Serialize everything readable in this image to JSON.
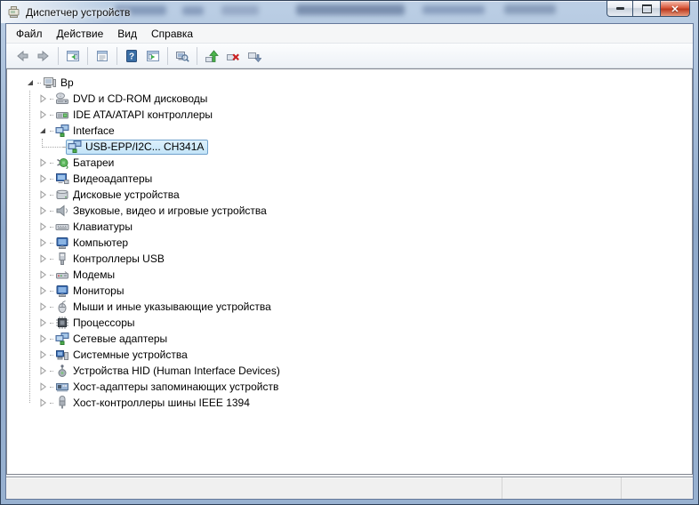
{
  "window": {
    "title": "Диспетчер устройств",
    "icon": "device-manager-icon",
    "caption_buttons": [
      {
        "name": "minimize-button",
        "icon": "minimize-icon"
      },
      {
        "name": "maximize-button",
        "icon": "maximize-icon"
      },
      {
        "name": "close-button",
        "icon": "close-icon"
      }
    ]
  },
  "menubar": {
    "items": [
      {
        "name": "file",
        "label": "Файл"
      },
      {
        "name": "action",
        "label": "Действие"
      },
      {
        "name": "view",
        "label": "Вид"
      },
      {
        "name": "help",
        "label": "Справка"
      }
    ]
  },
  "toolbar": {
    "buttons": [
      {
        "name": "back",
        "icon": "back-icon"
      },
      {
        "name": "forward",
        "icon": "forward-icon"
      },
      {
        "separator": true
      },
      {
        "name": "show-console-tree",
        "icon": "show-console-tree-icon"
      },
      {
        "separator": true
      },
      {
        "name": "properties",
        "icon": "properties-icon"
      },
      {
        "separator": true
      },
      {
        "name": "help",
        "icon": "help-icon"
      },
      {
        "name": "action-pane",
        "icon": "action-pane-icon"
      },
      {
        "separator": true
      },
      {
        "name": "scan-hardware-changes",
        "icon": "scan-hardware-icon"
      },
      {
        "separator": true
      },
      {
        "name": "update-driver",
        "icon": "update-driver-icon"
      },
      {
        "name": "uninstall-device",
        "icon": "uninstall-icon"
      },
      {
        "name": "disable-device",
        "icon": "disable-icon"
      }
    ]
  },
  "tree": {
    "items": [
      {
        "label": "Вр",
        "level": 0,
        "state": "expanded",
        "icon": "computer-icon"
      },
      {
        "label": "DVD и CD-ROM дисководы",
        "level": 1,
        "state": "collapsed",
        "icon": "dvd-icon"
      },
      {
        "label": "IDE ATA/ATAPI контроллеры",
        "level": 1,
        "state": "collapsed",
        "icon": "ide-icon"
      },
      {
        "label": "Interface",
        "level": 1,
        "state": "expanded",
        "icon": "interface-icon"
      },
      {
        "label": "USB-EPP/I2C... CH341A",
        "level": 2,
        "state": "leaf",
        "icon": "usb-epp-icon",
        "selected": true
      },
      {
        "label": "Батареи",
        "level": 1,
        "state": "collapsed",
        "icon": "battery-icon"
      },
      {
        "label": "Видеоадаптеры",
        "level": 1,
        "state": "collapsed",
        "icon": "display-adapter-icon"
      },
      {
        "label": "Дисковые устройства",
        "level": 1,
        "state": "collapsed",
        "icon": "disk-icon"
      },
      {
        "label": "Звуковые, видео и игровые устройства",
        "level": 1,
        "state": "collapsed",
        "icon": "sound-icon"
      },
      {
        "label": "Клавиатуры",
        "level": 1,
        "state": "collapsed",
        "icon": "keyboard-icon"
      },
      {
        "label": "Компьютер",
        "level": 1,
        "state": "collapsed",
        "icon": "computer-monitor-icon"
      },
      {
        "label": "Контроллеры USB",
        "level": 1,
        "state": "collapsed",
        "icon": "usb-icon"
      },
      {
        "label": "Модемы",
        "level": 1,
        "state": "collapsed",
        "icon": "modem-icon"
      },
      {
        "label": "Мониторы",
        "level": 1,
        "state": "collapsed",
        "icon": "monitor-icon"
      },
      {
        "label": "Мыши и иные указывающие устройства",
        "level": 1,
        "state": "collapsed",
        "icon": "mouse-icon"
      },
      {
        "label": "Процессоры",
        "level": 1,
        "state": "collapsed",
        "icon": "processor-icon"
      },
      {
        "label": "Сетевые адаптеры",
        "level": 1,
        "state": "collapsed",
        "icon": "network-icon"
      },
      {
        "label": "Системные устройства",
        "level": 1,
        "state": "collapsed",
        "icon": "system-icon"
      },
      {
        "label": "Устройства HID (Human Interface Devices)",
        "level": 1,
        "state": "collapsed",
        "icon": "hid-icon"
      },
      {
        "label": "Хост-адаптеры запоминающих устройств",
        "level": 1,
        "state": "collapsed",
        "icon": "storage-host-icon"
      },
      {
        "label": "Хост-контроллеры шины IEEE 1394",
        "level": 1,
        "state": "collapsed",
        "icon": "ieee1394-icon"
      }
    ]
  },
  "statusbar": {
    "sections": [
      "",
      "",
      ""
    ]
  },
  "colors": {
    "titlebar_glass": "#8fa9ca",
    "selection_fill": "#c3e4f8",
    "selection_top": "#ddf0fb",
    "selection_border": "#70a1cc",
    "close_button": "#d95b3e"
  }
}
